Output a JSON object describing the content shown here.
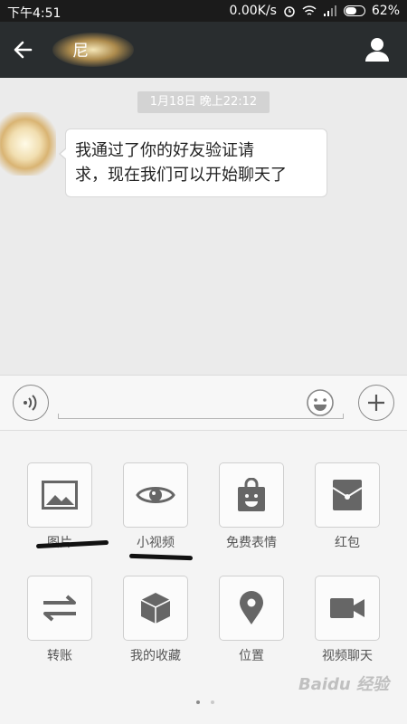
{
  "status_bar": {
    "time": "下午4:51",
    "speed": "0.00K/s",
    "battery": "62%",
    "battery_level": 0.62
  },
  "title_bar": {
    "contact_name": "尼"
  },
  "chat": {
    "timestamp": "1月18日 晚上22:12",
    "message_line1": "我通过了你的好友验证请",
    "message_line2": "求，现在我们可以开始聊天了"
  },
  "panel": {
    "items": [
      {
        "label": "图片",
        "icon": "image-icon"
      },
      {
        "label": "小视频",
        "icon": "eye-icon"
      },
      {
        "label": "免费表情",
        "icon": "sticker-bag-icon"
      },
      {
        "label": "红包",
        "icon": "red-packet-icon"
      },
      {
        "label": "转账",
        "icon": "transfer-icon"
      },
      {
        "label": "我的收藏",
        "icon": "favorites-cube-icon"
      },
      {
        "label": "位置",
        "icon": "location-pin-icon"
      },
      {
        "label": "视频聊天",
        "icon": "video-camera-icon"
      }
    ],
    "page_count": 2,
    "current_page": 1
  },
  "watermark": "Baidu 经验"
}
